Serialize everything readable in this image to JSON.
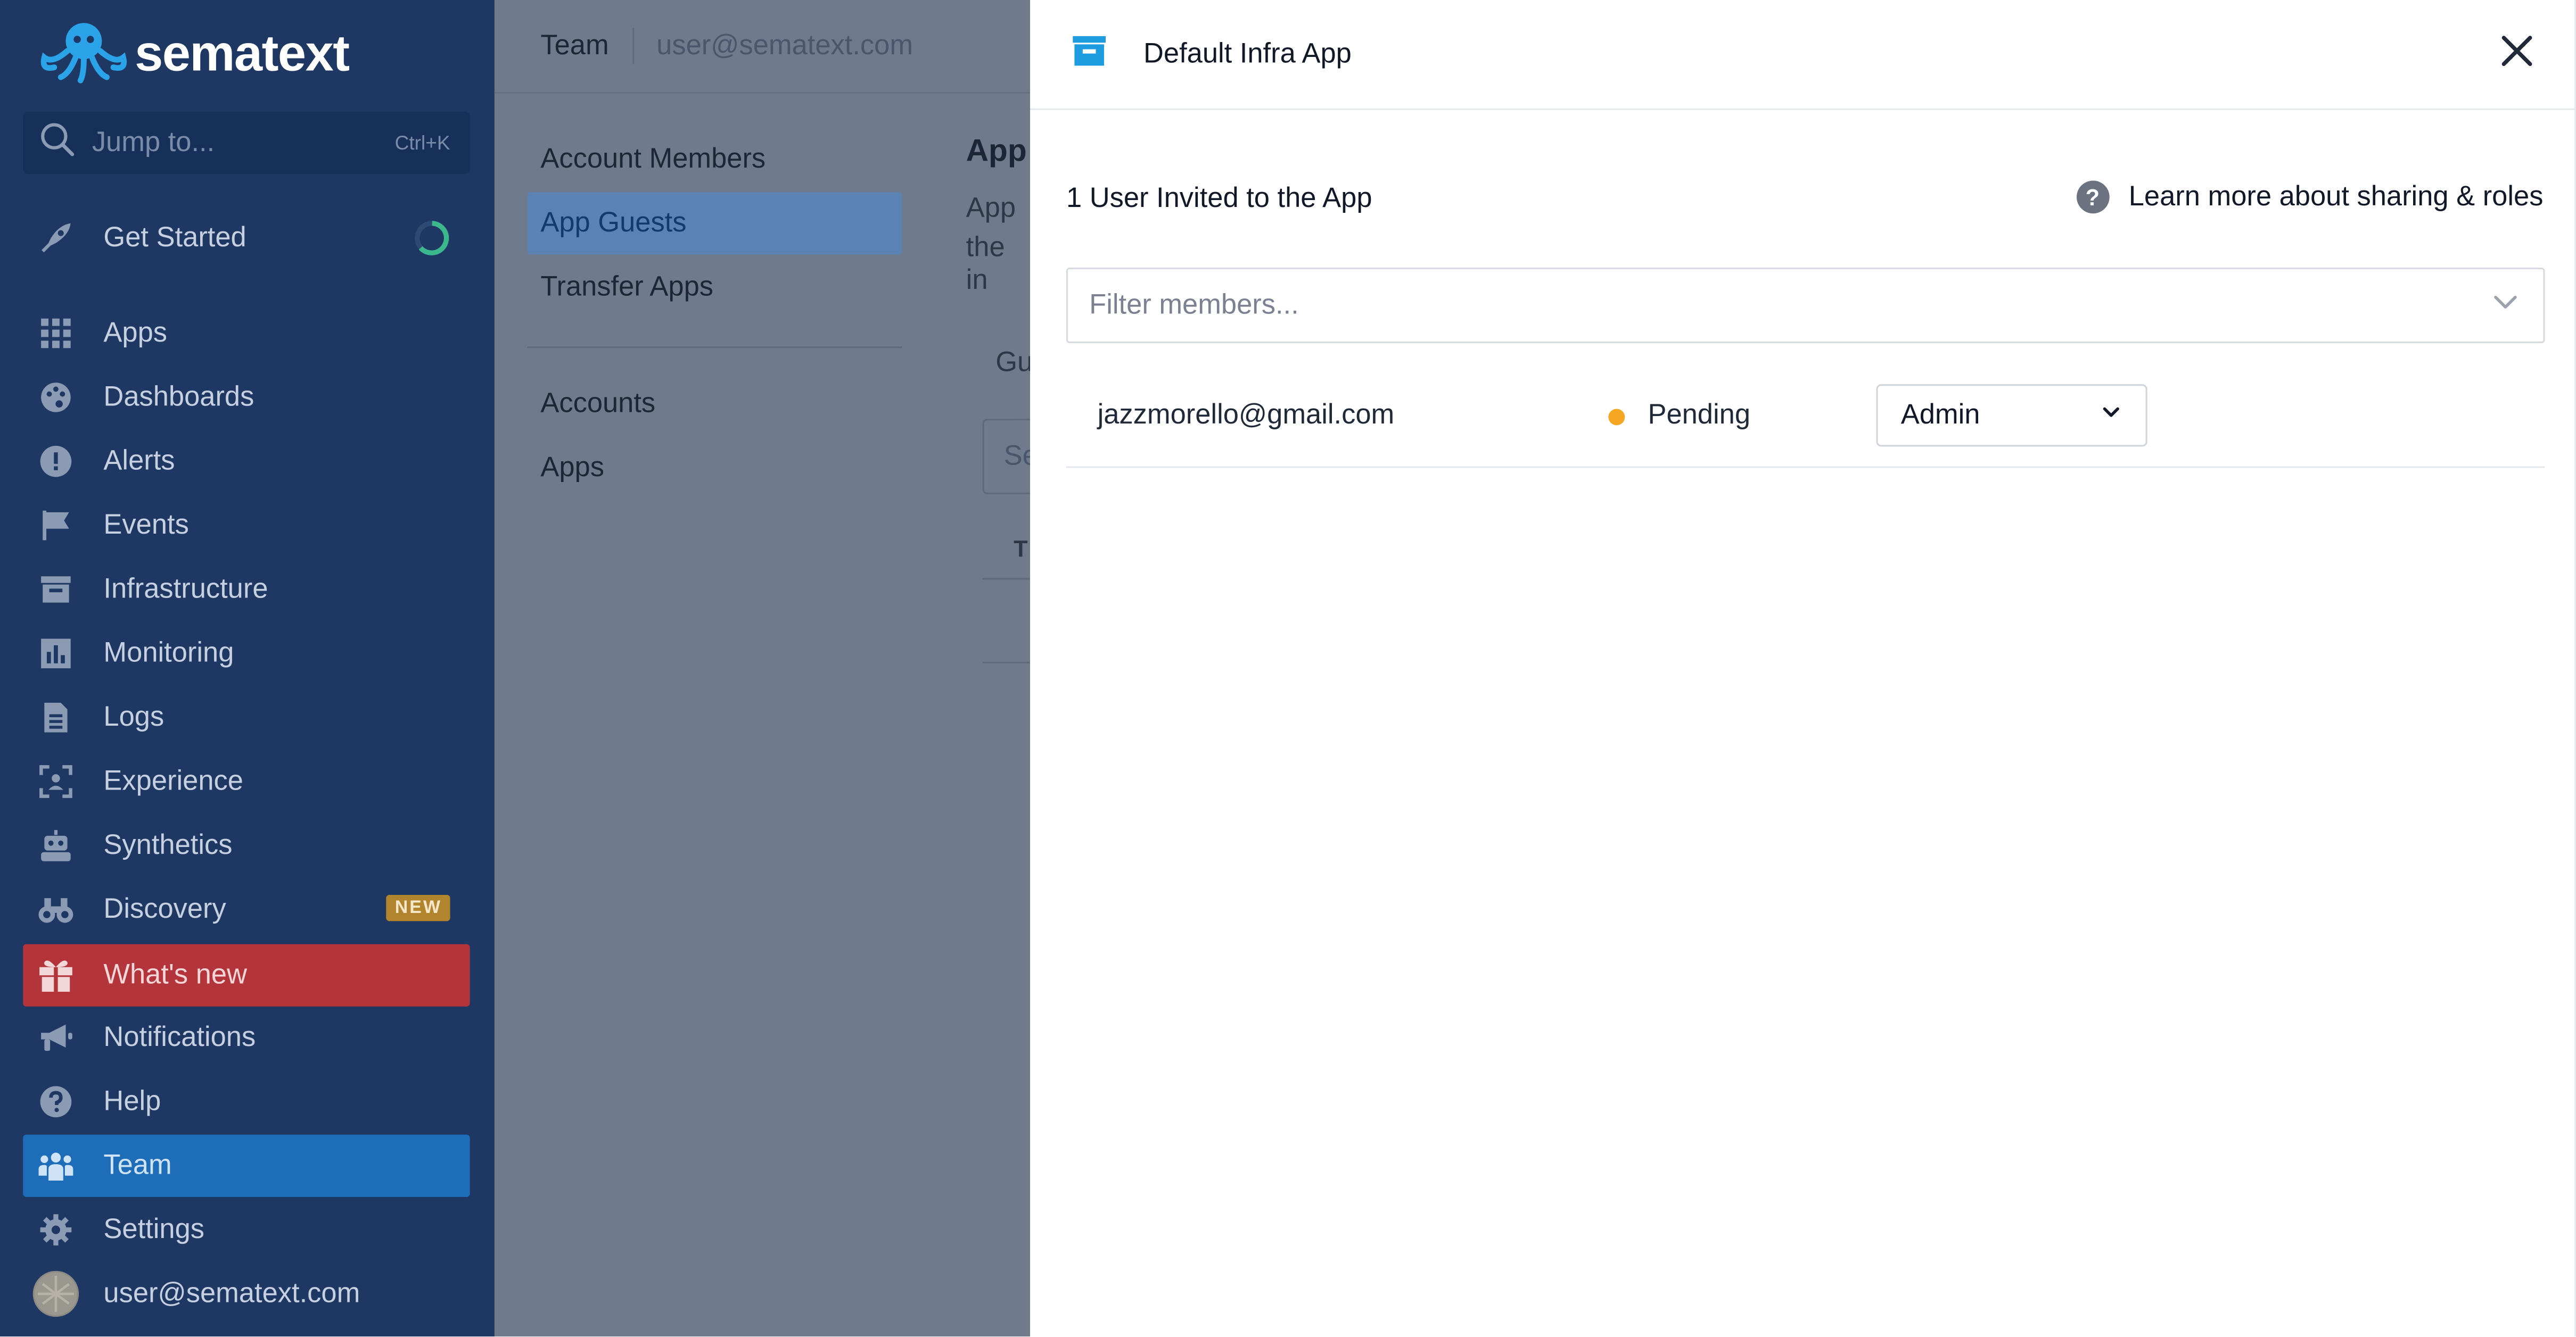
{
  "sidebar": {
    "brand": "sematext",
    "jump": {
      "placeholder": "Jump to...",
      "shortcut": "Ctrl+K"
    },
    "get_started": "Get Started",
    "items": [
      {
        "label": "Apps",
        "icon": "grid-icon"
      },
      {
        "label": "Dashboards",
        "icon": "palette-icon"
      },
      {
        "label": "Alerts",
        "icon": "alert-icon"
      },
      {
        "label": "Events",
        "icon": "flag-icon"
      },
      {
        "label": "Infrastructure",
        "icon": "archive-icon"
      },
      {
        "label": "Monitoring",
        "icon": "bar-chart-icon"
      },
      {
        "label": "Logs",
        "icon": "document-icon"
      },
      {
        "label": "Experience",
        "icon": "scan-icon"
      },
      {
        "label": "Synthetics",
        "icon": "robot-icon"
      },
      {
        "label": "Discovery",
        "icon": "binoculars-icon",
        "badge": "NEW"
      },
      {
        "label": "What's new",
        "icon": "gift-icon"
      },
      {
        "label": "Notifications",
        "icon": "megaphone-icon"
      },
      {
        "label": "Help",
        "icon": "help-icon"
      },
      {
        "label": "Team",
        "icon": "team-icon"
      },
      {
        "label": "Settings",
        "icon": "gear-icon"
      }
    ],
    "user": "user@sematext.com",
    "colors": {
      "background": "#1f3863",
      "active": "#1d6db8",
      "whats_new": "#b3343a",
      "badge": "#b2842e"
    }
  },
  "header": {
    "section": "Team",
    "user": "user@sematext.com"
  },
  "subnav": {
    "group1": [
      "Account Members",
      "App Guests",
      "Transfer Apps"
    ],
    "group2": [
      "Accounts",
      "Apps"
    ],
    "active": "App Guests"
  },
  "peek": {
    "title": "App",
    "line1": "App",
    "line2": "the in",
    "guests_label": "Gu",
    "search_fragment": "Se",
    "table_fragment": "T"
  },
  "drawer": {
    "title": "Default Infra App",
    "title_icon": "archive-icon",
    "invited_text": "1 User Invited to the App",
    "learn_more": "Learn more about sharing & roles",
    "filter": {
      "placeholder": "Filter members...",
      "value": ""
    },
    "members": [
      {
        "email": "jazzmorello@gmail.com",
        "status": "Pending",
        "status_color": "#f5a623",
        "role": "Admin"
      }
    ],
    "accent": "#1d9ce0"
  }
}
